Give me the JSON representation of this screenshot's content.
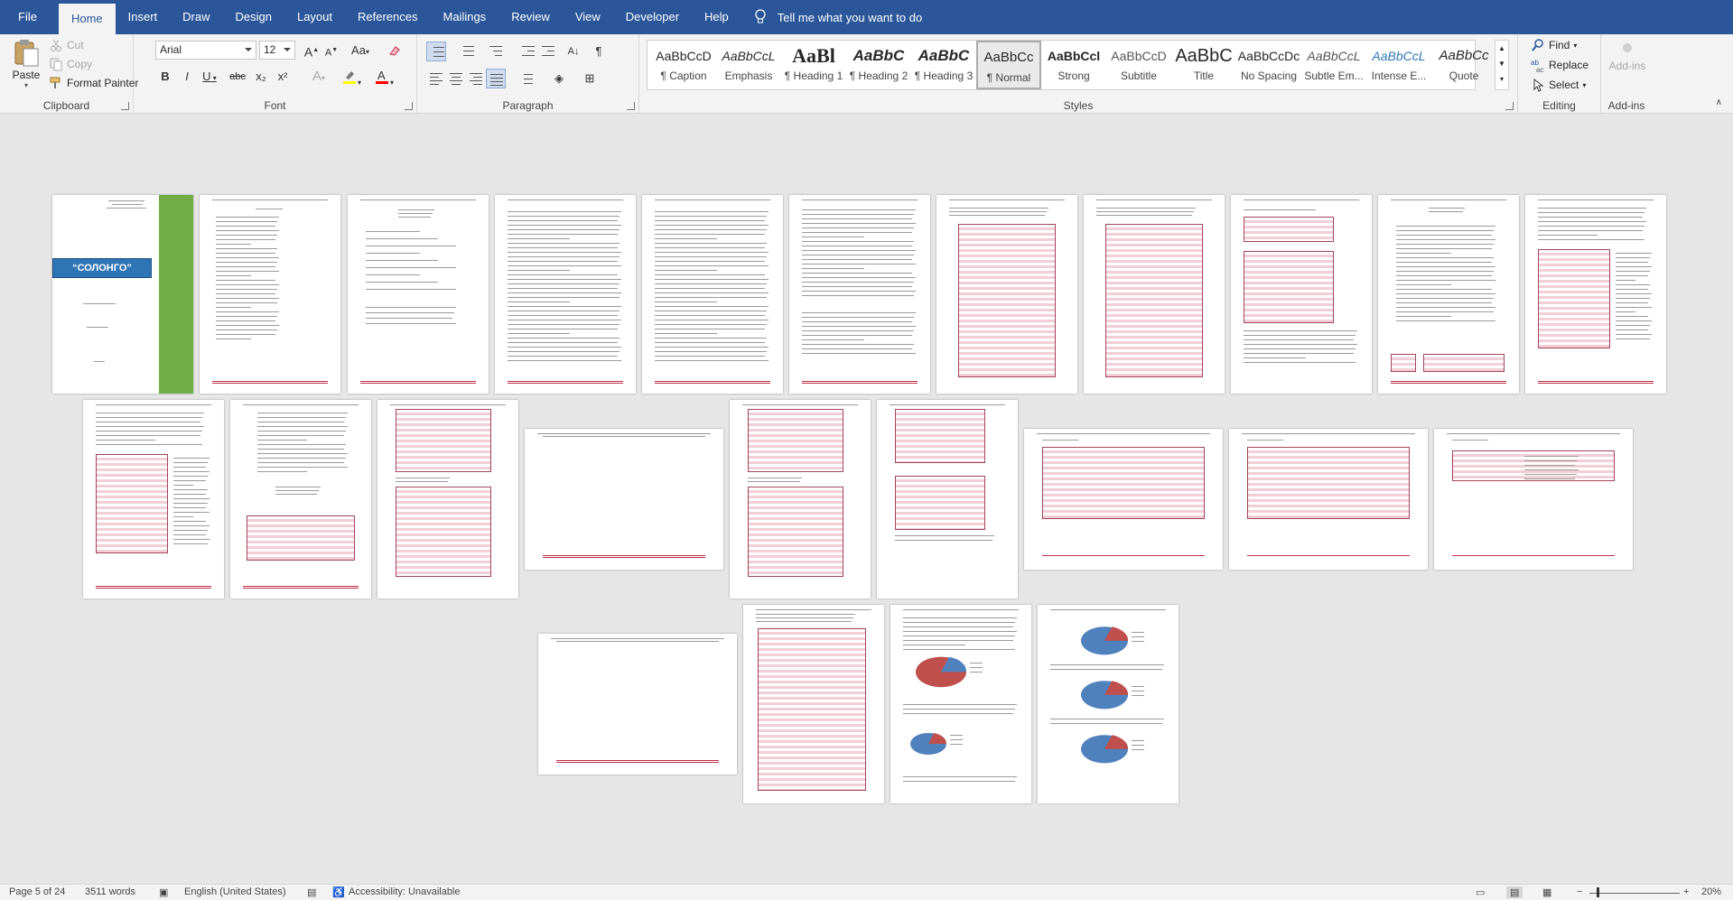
{
  "tabs": [
    "File",
    "Home",
    "Insert",
    "Draw",
    "Design",
    "Layout",
    "References",
    "Mailings",
    "Review",
    "View",
    "Developer",
    "Help"
  ],
  "active_tab": "Home",
  "tell_me": "Tell me what you want to do",
  "clipboard": {
    "paste": "Paste",
    "cut": "Cut",
    "copy": "Copy",
    "format_painter": "Format Painter",
    "label": "Clipboard"
  },
  "font": {
    "name": "Arial",
    "size": "12",
    "label": "Font",
    "bold": "B",
    "italic": "I",
    "underline": "U",
    "strike": "abc",
    "subscript": "x₂",
    "superscript": "x²",
    "grow": "A",
    "shrink": "A",
    "case": "Aa",
    "clear_icon": "eraser-icon",
    "highlight_color": "#ffff00",
    "font_color": "#ff0000"
  },
  "paragraph": {
    "label": "Paragraph",
    "pilcrow": "¶"
  },
  "styles": {
    "label": "Styles",
    "items": [
      {
        "sample": "AaBbCcD",
        "name": "¶ Caption"
      },
      {
        "sample": "AaBbCcL",
        "name": "Emphasis"
      },
      {
        "sample": "AaBl",
        "name": "¶ Heading 1"
      },
      {
        "sample": "AaBbC",
        "name": "¶ Heading 2"
      },
      {
        "sample": "AaBbC",
        "name": "¶ Heading 3"
      },
      {
        "sample": "AaBbCc",
        "name": "¶ Normal"
      },
      {
        "sample": "AaBbCcl",
        "name": "Strong"
      },
      {
        "sample": "AaBbCcD",
        "name": "Subtitle"
      },
      {
        "sample": "AaBbC",
        "name": "Title"
      },
      {
        "sample": "AaBbCcDc",
        "name": "No Spacing"
      },
      {
        "sample": "AaBbCcL",
        "name": "Subtle Em..."
      },
      {
        "sample": "AaBbCcL",
        "name": "Intense E..."
      },
      {
        "sample": "AaBbCc",
        "name": "Quote"
      }
    ],
    "selected": "¶ Normal"
  },
  "editing": {
    "find": "Find",
    "replace": "Replace",
    "select": "Select",
    "label": "Editing"
  },
  "addins": {
    "button": "Add-ins",
    "label": "Add-ins"
  },
  "document": {
    "cover_title": "“СОЛОНГО”",
    "accent_color": "#c0304a",
    "cover_color": "#2e75b6",
    "bar_color": "#70ad47"
  },
  "status": {
    "page": "Page 5 of 24",
    "words": "3511 words",
    "language": "English (United States)",
    "accessibility": "Accessibility: Unavailable",
    "zoom": "20%"
  }
}
